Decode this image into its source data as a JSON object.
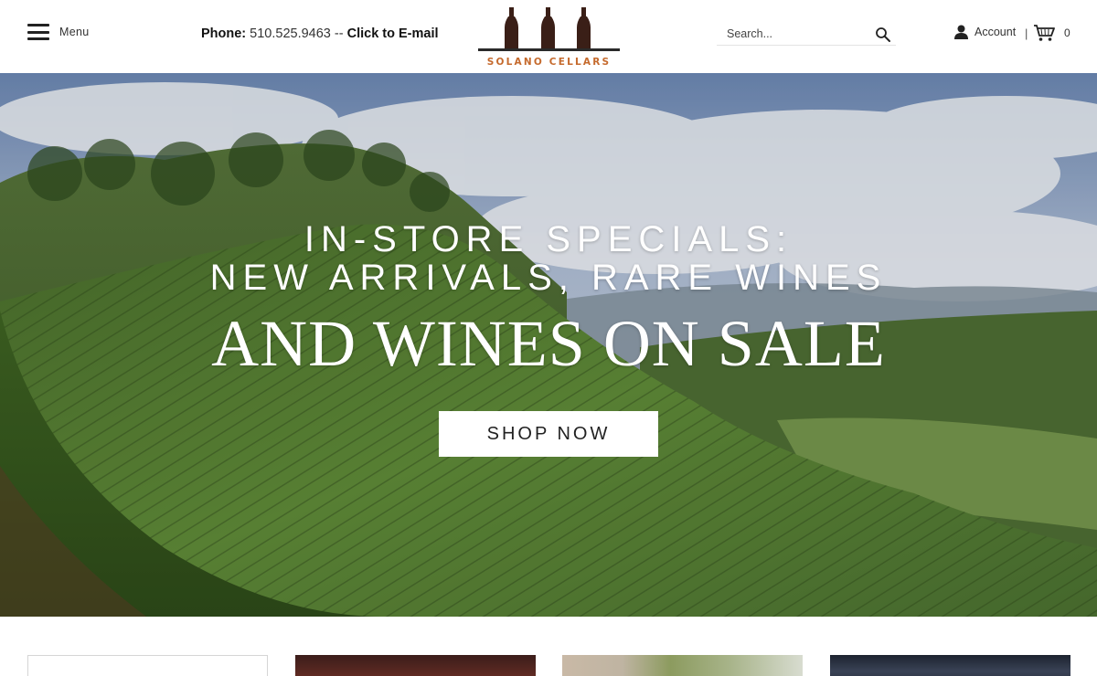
{
  "header": {
    "menu_label": "Menu",
    "phone_prefix": "Phone:",
    "phone_number": "510.525.9463",
    "phone_separator": "--",
    "email_link": "Click to E-mail",
    "logo_text": "SOLANO CELLARS",
    "search_placeholder": "Search...",
    "account_label": "Account",
    "separator": "|",
    "cart_count": "0"
  },
  "hero": {
    "line1": "IN-STORE SPECIALS:",
    "line2": "NEW ARRIVALS, RARE WINES",
    "line3": "AND WINES ON SALE",
    "button_label": "SHOP NOW"
  },
  "icons": {
    "menu": "hamburger-icon",
    "search": "search-icon",
    "account": "user-icon",
    "cart": "cart-icon",
    "logo": "wine-bottles-logo"
  },
  "colors": {
    "brand_orange": "#c56a2d",
    "bottle": "#3a1f17",
    "text_dark": "#222222"
  }
}
